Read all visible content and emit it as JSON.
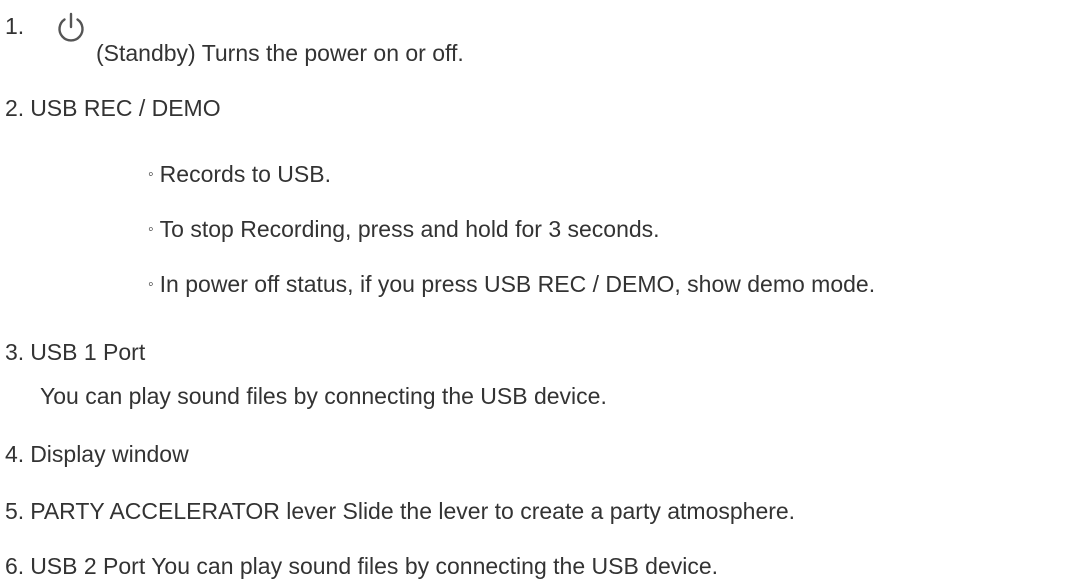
{
  "items": {
    "standby": {
      "number": "1.",
      "icon": "power-icon",
      "text": "(Standby) Turns the power on or off."
    },
    "usb_rec": {
      "number": "2.",
      "title": "USB REC / DEMO",
      "bullet_symbol": "◦",
      "bullets": [
        "Records to USB.",
        "To stop Recording, press and hold for 3 seconds.",
        "In power off status, if you press USB REC / DEMO, show demo mode."
      ]
    },
    "usb1": {
      "number": "3.",
      "title": "USB 1 Port",
      "description": "You can play sound files by connecting the USB device."
    },
    "display": {
      "number": "4.",
      "title": "Display window"
    },
    "party": {
      "number": "5.",
      "text": "PARTY ACCELERATOR lever Slide the lever to create a party atmosphere."
    },
    "usb2": {
      "number": "6.",
      "text": "USB 2 Port You can play sound files by connecting the USB device."
    }
  }
}
